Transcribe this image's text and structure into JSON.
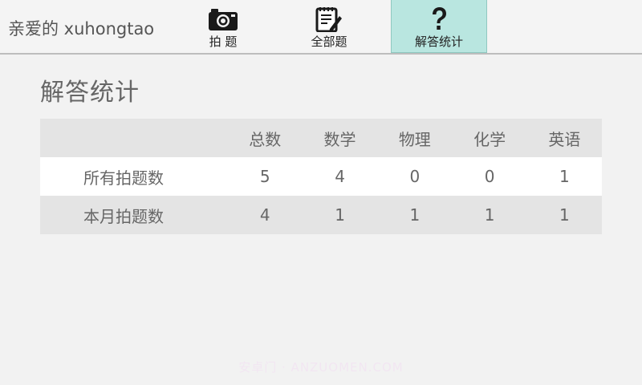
{
  "header": {
    "greeting": "亲爱的 xuhongtao",
    "tabs": [
      {
        "label": "拍 题",
        "icon": "camera-icon",
        "active": false
      },
      {
        "label": "全部题",
        "icon": "notebook-pencil-icon",
        "active": false
      },
      {
        "label": "解答统计",
        "icon": "question-mark-icon",
        "active": true
      }
    ]
  },
  "main": {
    "title": "解答统计",
    "table": {
      "columns": [
        "",
        "总数",
        "数学",
        "物理",
        "化学",
        "英语"
      ],
      "rows": [
        {
          "label": "所有拍题数",
          "values": [
            "5",
            "4",
            "0",
            "0",
            "1"
          ]
        },
        {
          "label": "本月拍题数",
          "values": [
            "4",
            "1",
            "1",
            "1",
            "1"
          ]
        }
      ]
    }
  },
  "watermark": "安卓门 · ANZUOMEN.COM",
  "colors": {
    "background": "#f2f2f2",
    "active_tab": "#b9e6e0",
    "table_stripe": "#e4e4e4",
    "text": "#666666"
  }
}
